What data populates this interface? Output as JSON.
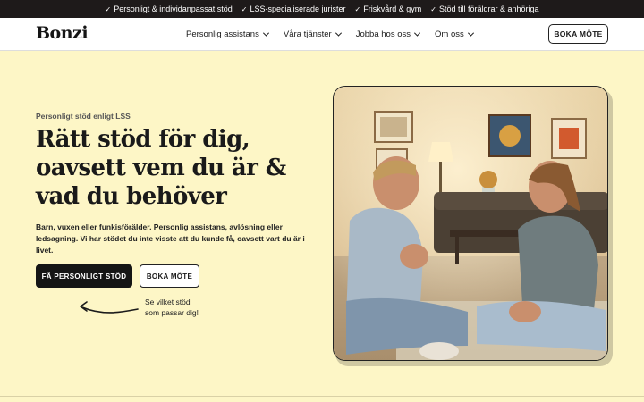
{
  "topbar": {
    "usps": [
      "Personligt & individanpassat stöd",
      "LSS-specialiserade jurister",
      "Friskvård & gym",
      "Stöd till föräldrar & anhöriga"
    ]
  },
  "nav": {
    "logo": "Bonzi",
    "menu": [
      {
        "label": "Personlig assistans"
      },
      {
        "label": "Våra tjänster"
      },
      {
        "label": "Jobba hos oss"
      },
      {
        "label": "Om oss"
      }
    ],
    "cta": "BOKA MÖTE"
  },
  "hero": {
    "eyebrow": "Personligt stöd enligt LSS",
    "headline": "Rätt stöd för dig, oavsett vem du är & vad du behöver",
    "lead": "Barn, vuxen eller funkisförälder. Personlig assistans, avlösning eller ledsagning. Vi har stödet du inte visste att du kunde få, oavsett vart du är i livet.",
    "primary_button": "FÅ PERSONLIGT STÖD",
    "secondary_button": "BOKA MÖTE",
    "hint_line1": "Se vilket stöd",
    "hint_line2": "som passar dig!"
  },
  "icons": {
    "check": "check-icon",
    "chevron": "chevron-down-icon",
    "arrow": "curved-arrow-icon"
  },
  "colors": {
    "background": "#fdf6c6",
    "topbar": "#1e1a1a",
    "primary_button": "#151515"
  }
}
